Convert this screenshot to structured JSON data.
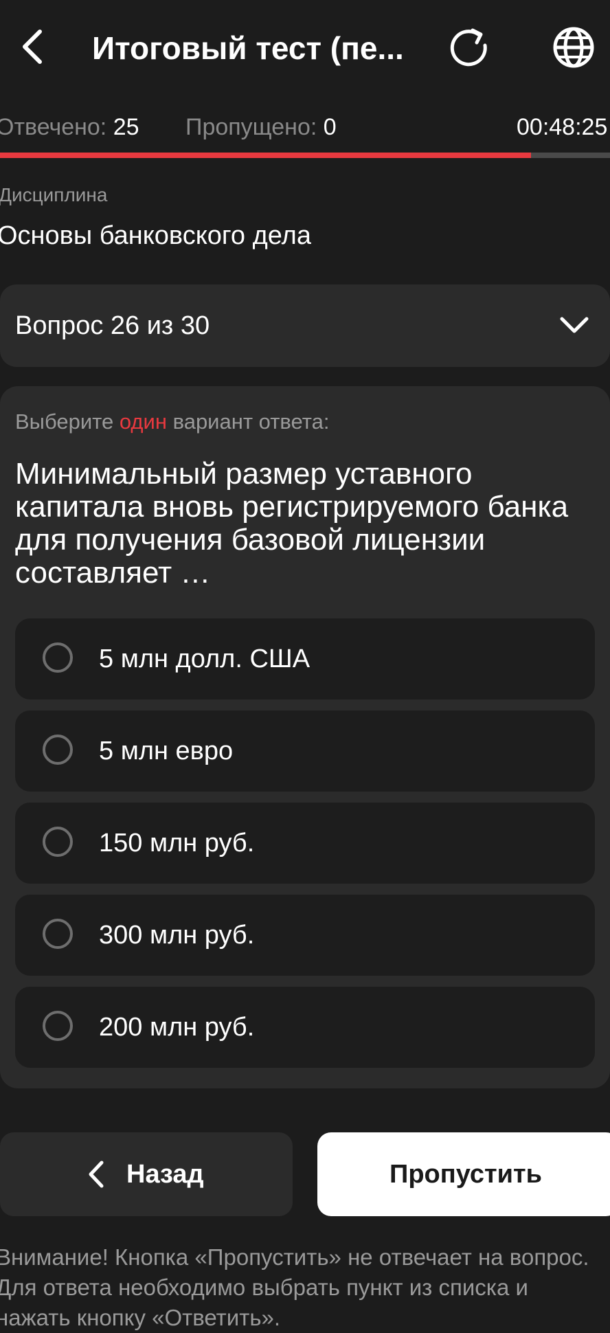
{
  "header": {
    "title": "Итоговый тест (пе...",
    "back_icon": "chevron-left-icon",
    "refresh_icon": "refresh-icon",
    "language_icon": "globe-icon"
  },
  "stats": {
    "answered_label": "Отвечено:",
    "answered_value": "25",
    "skipped_label": "Пропущено:",
    "skipped_value": "0",
    "timer": "00:48:25"
  },
  "progress": {
    "fraction": 0.87,
    "color": "#e8393f"
  },
  "discipline": {
    "label": "Дисциплина",
    "value": "Основы банковского дела"
  },
  "question_selector": {
    "label": "Вопрос 26 из 30",
    "icon": "chevron-down-icon"
  },
  "question": {
    "hint_prefix": "Выберите ",
    "hint_accent": "один",
    "hint_suffix": " вариант ответа:",
    "text": "Минимальный размер уставного капитала вновь регистрируемого банка для получения базовой лицензии составляет …",
    "options": [
      {
        "label": "5 млн долл. США"
      },
      {
        "label": "5 млн евро"
      },
      {
        "label": "150 млн руб."
      },
      {
        "label": "300 млн руб."
      },
      {
        "label": "200 млн руб."
      }
    ]
  },
  "buttons": {
    "back_label": "Назад",
    "skip_label": "Пропустить"
  },
  "notice": "Внимание! Кнопка «Пропустить» не отвечает на вопрос. Для ответа необходимо выбрать пункт из списка и нажать кнопку «Ответить».",
  "colors": {
    "accent": "#e8393f",
    "background": "#1c1c1c",
    "card": "#2b2b2b"
  }
}
